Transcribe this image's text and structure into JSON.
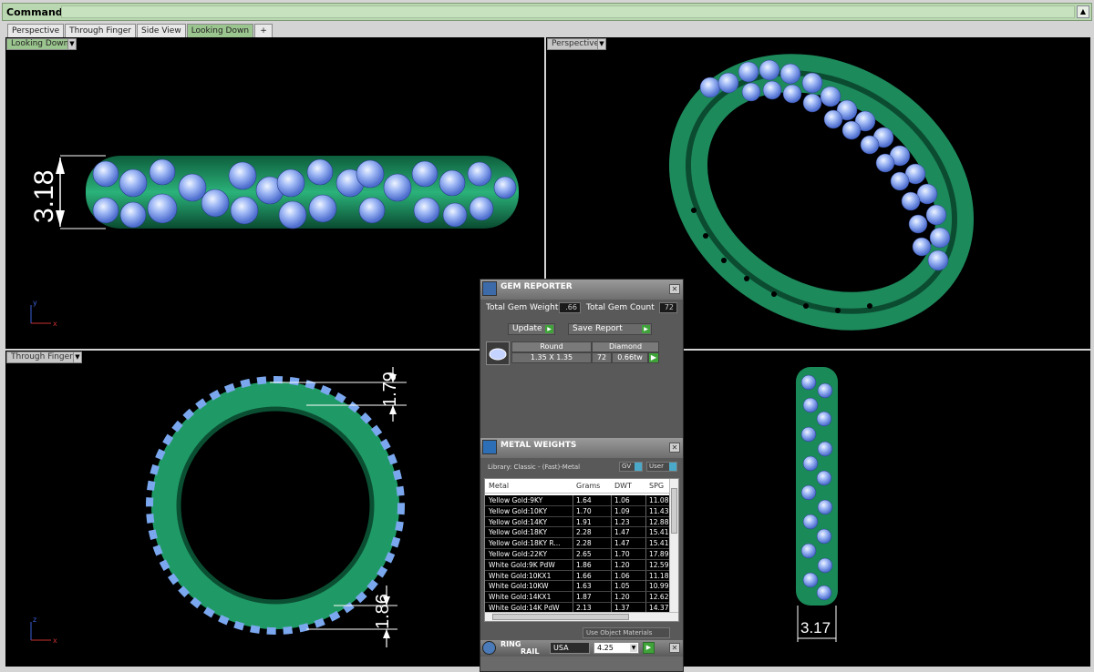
{
  "command": {
    "label": "Command:",
    "value": ""
  },
  "tabs": [
    {
      "label": "Perspective"
    },
    {
      "label": "Through Finger"
    },
    {
      "label": "Side View"
    },
    {
      "label": "Looking Down"
    },
    {
      "label": "+"
    }
  ],
  "viewports": {
    "top_left": {
      "label": "Looking Down",
      "dimension": "3.18",
      "axis_v": "y",
      "axis_h": "x"
    },
    "top_right": {
      "label": "Perspective"
    },
    "bottom_left": {
      "label": "Through Finger",
      "dimension_top": "1.79",
      "dimension_bottom": "1.86",
      "axis_v": "z",
      "axis_h": "x"
    },
    "bottom_right": {
      "dimension": "3.17"
    }
  },
  "gem_reporter": {
    "title": "GEM REPORTER",
    "total_weight_label": "Total Gem Weight",
    "total_weight_value": ".66",
    "total_count_label": "Total Gem Count",
    "total_count_value": "72",
    "update_label": "Update",
    "save_report_label": "Save Report",
    "gem": {
      "shape": "Round",
      "material": "Diamond",
      "size": "1.35 X 1.35",
      "count": "72",
      "weight": "0.66tw"
    }
  },
  "metal_weights": {
    "title": "METAL WEIGHTS",
    "library": "Library: Classic - (Fast)-Metal",
    "gv_label": "GV",
    "user_label": "User",
    "columns": [
      "Metal",
      "Grams",
      "DWT",
      "SPG"
    ],
    "rows": [
      [
        "Yellow Gold:9KY",
        "1.64",
        "1.06",
        "11.08"
      ],
      [
        "Yellow Gold:10KY",
        "1.70",
        "1.09",
        "11.43"
      ],
      [
        "Yellow Gold:14KY",
        "1.91",
        "1.23",
        "12.88"
      ],
      [
        "Yellow Gold:18KY",
        "2.28",
        "1.47",
        "15.41"
      ],
      [
        "Yellow Gold:18KY R...",
        "2.28",
        "1.47",
        "15.41"
      ],
      [
        "Yellow Gold:22KY",
        "2.65",
        "1.70",
        "17.89"
      ],
      [
        "White Gold:9K PdW",
        "1.86",
        "1.20",
        "12.59"
      ],
      [
        "White Gold:10KX1",
        "1.66",
        "1.06",
        "11.18"
      ],
      [
        "White Gold:10KW",
        "1.63",
        "1.05",
        "10.99"
      ],
      [
        "White Gold:14KX1",
        "1.87",
        "1.20",
        "12.62"
      ],
      [
        "White Gold:14K PdW",
        "2.13",
        "1.37",
        "14.37"
      ]
    ],
    "use_object_materials": "Use Object Materials"
  },
  "ring_rail": {
    "title_line1": "RING",
    "title_line2": "RAIL",
    "standard": "USA",
    "size": "4.25"
  }
}
